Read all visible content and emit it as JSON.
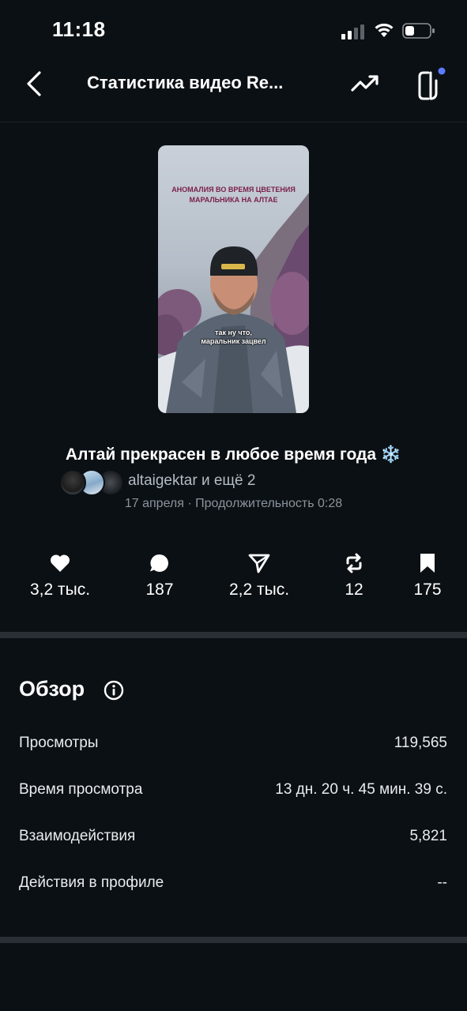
{
  "status_bar": {
    "time": "11:18"
  },
  "header": {
    "title": "Статистика видео Re..."
  },
  "video": {
    "overlay_title_line1": "АНОМАЛИЯ ВО ВРЕМЯ ЦВЕТЕНИЯ",
    "overlay_title_line2": "МАРАЛЬНИКА НА АЛТАЕ",
    "caption_line1": "так ну что,",
    "caption_line2": "маральник зацвел"
  },
  "post": {
    "title": "Алтай прекрасен в любое время года",
    "title_emoji": "❄️",
    "authors": "altaigektar и ещё 2",
    "meta": "17 апреля · Продолжительность 0:28"
  },
  "stats": {
    "likes": "3,2 тыс.",
    "comments": "187",
    "shares": "2,2 тыс.",
    "reposts": "12",
    "saves": "175"
  },
  "overview": {
    "title": "Обзор",
    "rows": [
      {
        "label": "Просмотры",
        "value": "119,565"
      },
      {
        "label": "Время просмотра",
        "value": "13 дн. 20 ч. 45 мин. 39 с."
      },
      {
        "label": "Взаимодействия",
        "value": "5,821"
      },
      {
        "label": "Действия в профиле",
        "value": "--"
      }
    ]
  },
  "icons": {
    "back": "chevron-left-icon",
    "trend": "trending-up-icon",
    "compose": "threads-compose-icon",
    "like": "heart-icon",
    "comment": "comment-bubble-icon",
    "share": "send-icon",
    "repost": "repost-icon",
    "save": "bookmark-icon",
    "info": "info-icon"
  },
  "colors": {
    "background": "#0b1014",
    "notification_dot": "#5b7cff",
    "secondary_text": "#8b949c"
  }
}
